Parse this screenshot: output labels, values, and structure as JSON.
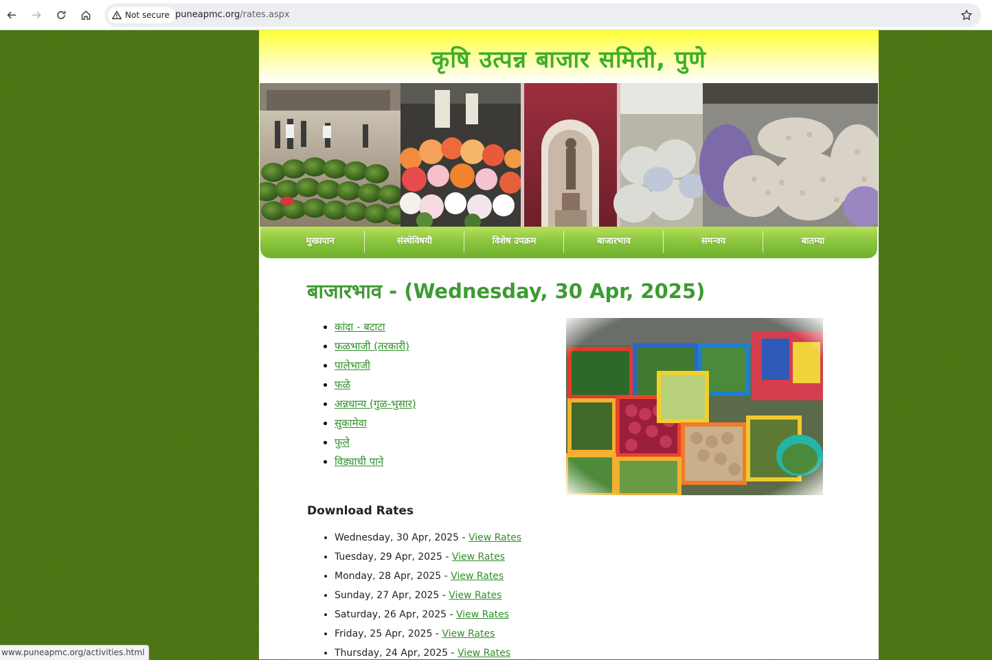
{
  "browser": {
    "security_label": "Not secure",
    "url_domain": "puneapmc.org",
    "url_path": "/rates.aspx",
    "status_url": "www.puneapmc.org/activities.html"
  },
  "site": {
    "title": "कृषि उत्पन्न बाजार समिती, पुणे",
    "nav": [
      "मुख्यपान",
      "संस्थेविषयी",
      "विशेष उपक्रम",
      "बाजारभाव",
      "समन्वय",
      "बातम्या"
    ]
  },
  "main": {
    "heading": "बाजारभाव - (Wednesday, 30 Apr, 2025)",
    "categories": [
      "कांदा - बटाटा",
      "फळभाजी (तरकारी)",
      "पालेभाजी",
      "फळे",
      "अन्नधान्य (गुळ-भुसार)",
      "सुकामेवा",
      "फुले",
      "विड्याची पाने"
    ],
    "download_heading": "Download Rates",
    "view_label": "View Rates",
    "rates": [
      "Wednesday, 30 Apr, 2025 -",
      "Tuesday, 29 Apr, 2025 -",
      "Monday, 28 Apr, 2025 -",
      "Sunday, 27 Apr, 2025 -",
      "Saturday, 26 Apr, 2025 -",
      "Friday, 25 Apr, 2025 -",
      "Thursday, 24 Apr, 2025 -"
    ]
  },
  "colors": {
    "page_bg": "#4a7412",
    "nav_green": "#8cc63f",
    "heading_green": "#3c9b31",
    "link_green": "#2f8f27",
    "title_green": "#3fae2a"
  },
  "icons": [
    "back-arrow-icon",
    "forward-arrow-icon",
    "reload-icon",
    "home-icon",
    "warning-icon",
    "star-icon"
  ]
}
